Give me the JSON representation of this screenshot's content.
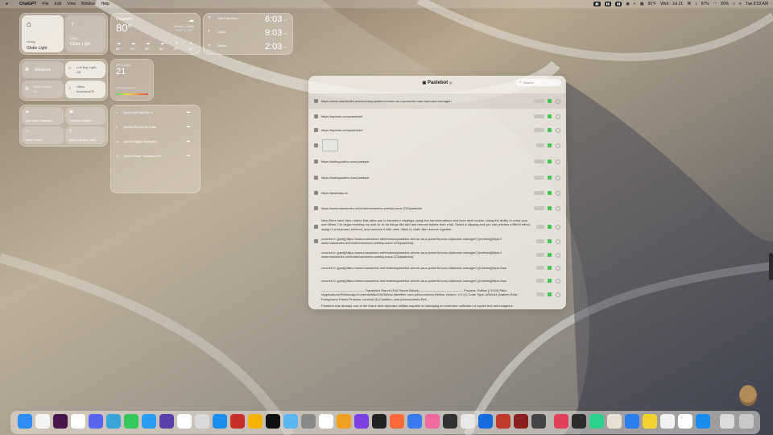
{
  "menubar": {
    "app": "ChatGPT",
    "items": [
      "File",
      "Edit",
      "View",
      "Window",
      "Help"
    ],
    "status": [
      "80°F",
      "Wed · Jul 21",
      "87%",
      "80%",
      "Tue 8:53 AM"
    ]
  },
  "home": {
    "tile1": {
      "name": "Globe Light",
      "sub": "Living"
    },
    "tile2": {
      "name": "Globe Light",
      "sub": "Office"
    },
    "windows": "Windows",
    "office_shade": {
      "name": "Office Shade",
      "sub": "Off"
    },
    "left_bay": {
      "name": "Left Bay Light",
      "sub": "Off"
    },
    "bookshelf": {
      "name": "Bookshelf Pl...",
      "sub": "Office"
    }
  },
  "weather": {
    "city": "Davidson",
    "temp": "80°",
    "condition": "Mostly Cloudy",
    "hilo": "H:90° L:71°",
    "hours": [
      "80°",
      "81°",
      "83°",
      "86°",
      "87°",
      "88°"
    ]
  },
  "clocks": [
    {
      "city": "San Francisco",
      "time": "6:03",
      "ampm": "AM"
    },
    {
      "city": "Local",
      "time": "9:03",
      "ampm": "AM"
    },
    {
      "city": "Dublin",
      "time": "2:03",
      "ampm": "PM"
    }
  ],
  "air_quality": {
    "label": "Air Quality",
    "value": "21",
    "desc": "Air quality is good."
  },
  "shortcuts": [
    "Quit Non-Obsidian",
    "Upload Images 1",
    "New Folder",
    "Add Link from Saf..."
  ],
  "devices": [
    "John's AirPods Pro 2",
    "John's iPhone 14 Case",
    "John's Magic Keyboard",
    "John's Magic Trackpad RE"
  ],
  "pastebot": {
    "title": "Pastebot",
    "search_placeholder": "Search",
    "rows": [
      "https://www.macstories.net/reviews/pastebot-reborn-as-a-powerful-mac-clipboard-manager/",
      "https://tapbots.com/pastebot/",
      "https://tapbots.com/pastebot/",
      "",
      "https://indiegoodies.com/pastepal",
      "https://indiegoodies.com/pastepal",
      "https://pasteapp.io",
      "https://www.macstories.net/club/macstories-weekly-issue-225/pasteboi",
      "New filters have been added that allow you to transform clippings using text transformations and even shell scripts. Using the ability to script your own filters, I've begun building my own to. to do things like add and remove bullets from a list. Select a clipping and you can preview a filter's effect, assign it a keyboard shortcut, and combine it with other filters to chain filter actions together.",
      "covered in [past](https://www.macstories.net/reviews/pastebot-reborn-as-a-powerful-mac-clipboard-manager/) [reviews](https:// www.macstories.net/club/macstories-weekly-issue-225/pasteboi).",
      "covered in [past](https://www.macstories.net/reviews/pastebot-reborn-as-a-powerful-mac-clipboard-manager/) [reviews](https:// www.macstories.net/club/macstories-weekly-issue-225/pasteboi).",
      "covered in [past](https://www.macstories.net/reviews/pastebot-reborn-as-a-powerful-mac-clipboard-manager/) [reviews](https://ww",
      "covered in [past](https://www.macstories.net/reviews/pastebot-reborn-as-a-powerful-mac-clipboard-manager/) [reviews](https://ww",
      "---------------------------------------- Translated Report (Full Report Below) ---------------------------------------- Process: Reflow [71010] Path: /Applications/Reflow.app/Contents/MacOS/Reflow Identifier: com.johnvoorhees.Reflow Version: 1.0 (1) Code Type: ARM-64 (Native) Role: Foreground Parent Process: launchd [1] Coalition: com.johnvoorhees.Ref...",
      "Pastebot was already one of the Mac's best clipboard utilities capable of managing an extensive collection of copied text and images in"
    ]
  },
  "colors": {
    "accent_green": "#43c453"
  }
}
